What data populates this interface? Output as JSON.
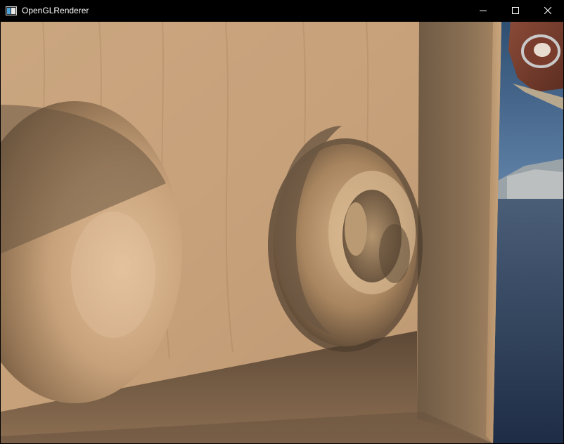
{
  "window": {
    "title": "OpenGLRenderer"
  },
  "caption_buttons": {
    "minimize_icon": "minimize-icon",
    "maximize_icon": "maximize-icon",
    "close_icon": "close-icon"
  },
  "colors": {
    "titlebar_bg": "#000000",
    "title_text": "#ffffff",
    "wood_light": "#c9a27a",
    "wood_shadow": "#6e5a43",
    "sky": "#7b9bbf",
    "sea": "#2c3e58"
  }
}
